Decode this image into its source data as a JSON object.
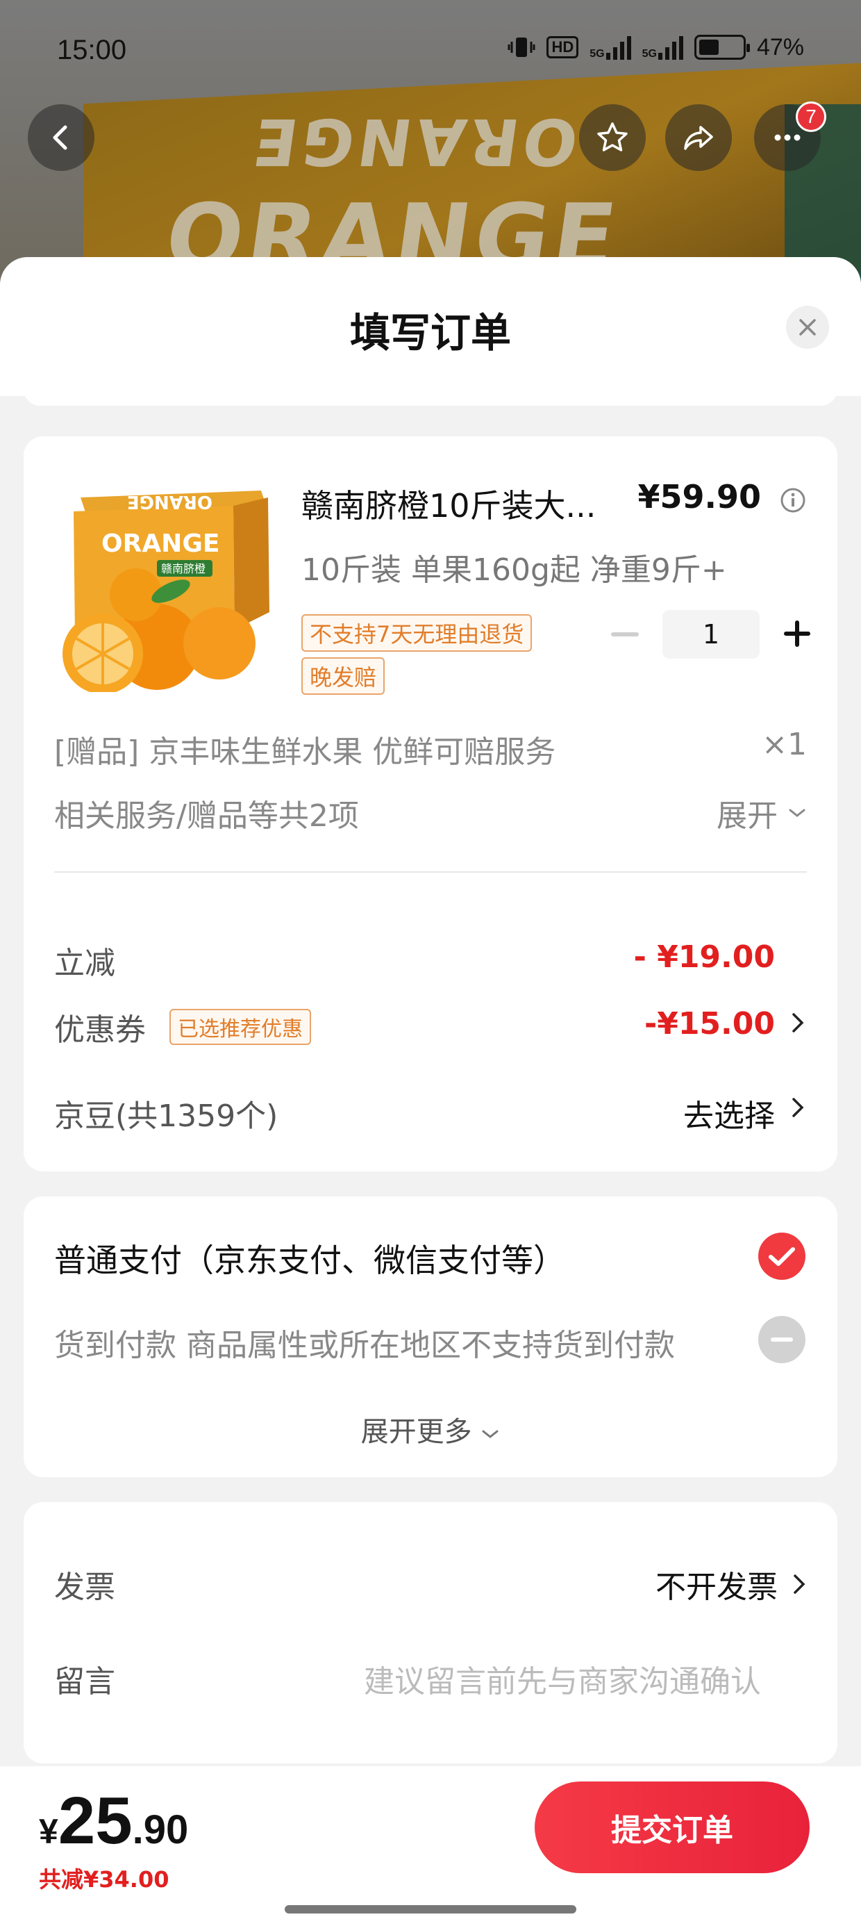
{
  "status_bar": {
    "time": "15:00",
    "battery": "47%",
    "hd_label": "HD",
    "net1": "5G",
    "net2": "5G",
    "battery_level": 0.47
  },
  "top_buttons": {
    "notification_count": "7"
  },
  "background": {
    "box_text_top": "ORANGE",
    "box_text_main": "ORANGE"
  },
  "sheet": {
    "title": "填写订单"
  },
  "product": {
    "name": "赣南脐橙10斤装大...",
    "price": "¥59.90",
    "spec": "10斤装 单果160g起 净重9斤+",
    "tag1": "不支持7天无理由退货",
    "tag2": "晚发赔",
    "quantity": "1",
    "image_box_text": "ORANGE",
    "image_label": "赣南脐橙"
  },
  "gift": {
    "text": "[赠品]  京丰味生鲜水果 优鲜可赔服务",
    "qty": "×1"
  },
  "services": {
    "text": "相关服务/赠品等共2项",
    "expand_label": "展开"
  },
  "discounts": {
    "instant_label": "立减",
    "instant_value": "- ¥19.00",
    "coupon_label": "优惠券",
    "coupon_tag": "已选推荐优惠",
    "coupon_value": "-¥15.00",
    "beans_label": "京豆(共1359个)",
    "beans_action": "去选择"
  },
  "payment": {
    "option1": "普通支付（京东支付、微信支付等）",
    "option2": "货到付款 商品属性或所在地区不支持货到付款",
    "more_label": "展开更多"
  },
  "invoice": {
    "invoice_label": "发票",
    "invoice_value": "不开发票",
    "message_label": "留言",
    "message_placeholder": "建议留言前先与商家沟通确认"
  },
  "footer": {
    "currency": "¥",
    "total_int": "25",
    "total_dec": ".90",
    "saved": "共减¥34.00",
    "submit_label": "提交订单"
  },
  "colors": {
    "accent_red": "#e21f1f",
    "submit_start": "#f53a46",
    "submit_end": "#e8223a",
    "tag_orange": "#e17d2a"
  }
}
